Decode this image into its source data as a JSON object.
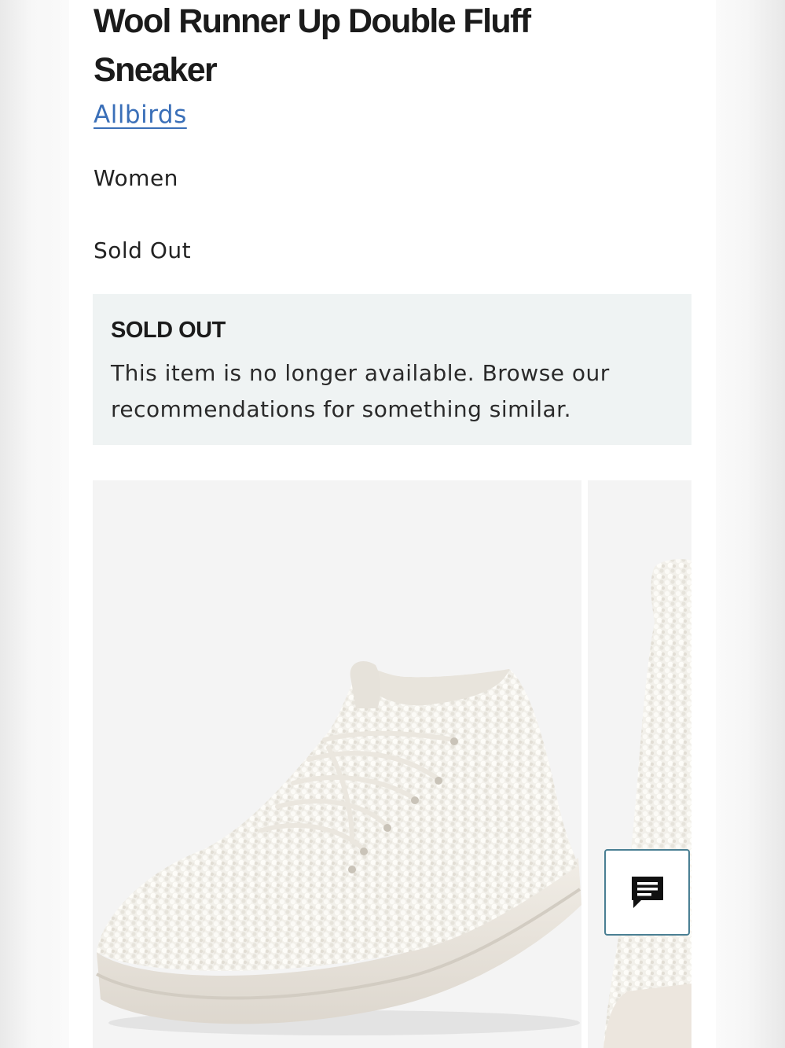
{
  "product": {
    "title": "Wool Runner Up Double Fluff Sneaker",
    "brand": "Allbirds",
    "gender": "Women",
    "status": "Sold Out"
  },
  "notice": {
    "title": "SOLD OUT",
    "body": "This item is no longer available. Browse our recommendations for something similar."
  },
  "gallery": {
    "images": [
      "sneaker-side-view",
      "sneaker-rear-view"
    ]
  },
  "chat": {
    "icon": "chat-bubble-icon"
  },
  "colors": {
    "link": "#3a6fb8",
    "notice_bg": "#eff3f3",
    "chat_border": "#4a7f93"
  }
}
